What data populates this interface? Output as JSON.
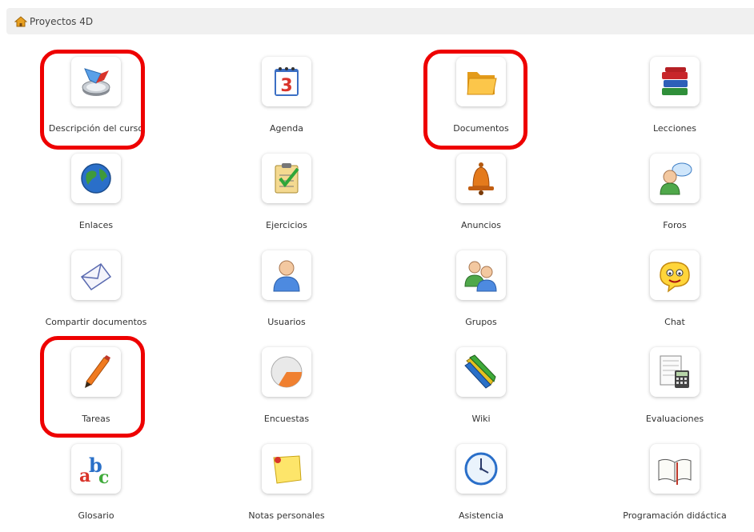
{
  "breadcrumb": {
    "label": "Proyectos 4D",
    "icon": "home-icon"
  },
  "tools": [
    {
      "label": "Descripción del curso",
      "icon": "compass-icon"
    },
    {
      "label": "Agenda",
      "icon": "calendar-icon"
    },
    {
      "label": "Documentos",
      "icon": "folder-icon"
    },
    {
      "label": "Lecciones",
      "icon": "books-icon"
    },
    {
      "label": "Enlaces",
      "icon": "globe-icon"
    },
    {
      "label": "Ejercicios",
      "icon": "checklist-icon"
    },
    {
      "label": "Anuncios",
      "icon": "bell-icon"
    },
    {
      "label": "Foros",
      "icon": "forum-user-icon"
    },
    {
      "label": "Compartir documentos",
      "icon": "envelope-icon"
    },
    {
      "label": "Usuarios",
      "icon": "user-icon"
    },
    {
      "label": "Grupos",
      "icon": "group-icon"
    },
    {
      "label": "Chat",
      "icon": "chat-face-icon"
    },
    {
      "label": "Tareas",
      "icon": "pen-icon"
    },
    {
      "label": "Encuestas",
      "icon": "pie-chart-icon"
    },
    {
      "label": "Wiki",
      "icon": "pencils-icon"
    },
    {
      "label": "Evaluaciones",
      "icon": "calculator-sheet-icon"
    },
    {
      "label": "Glosario",
      "icon": "abc-icon"
    },
    {
      "label": "Notas personales",
      "icon": "sticky-note-icon"
    },
    {
      "label": "Asistencia",
      "icon": "clock-icon"
    },
    {
      "label": "Programación didáctica",
      "icon": "open-book-icon"
    }
  ],
  "highlighted_tools": [
    "Descripción del curso",
    "Documentos",
    "Tareas"
  ],
  "colors": {
    "highlight": "#ee0000",
    "breadcrumb_bg": "#f0f0f0"
  }
}
